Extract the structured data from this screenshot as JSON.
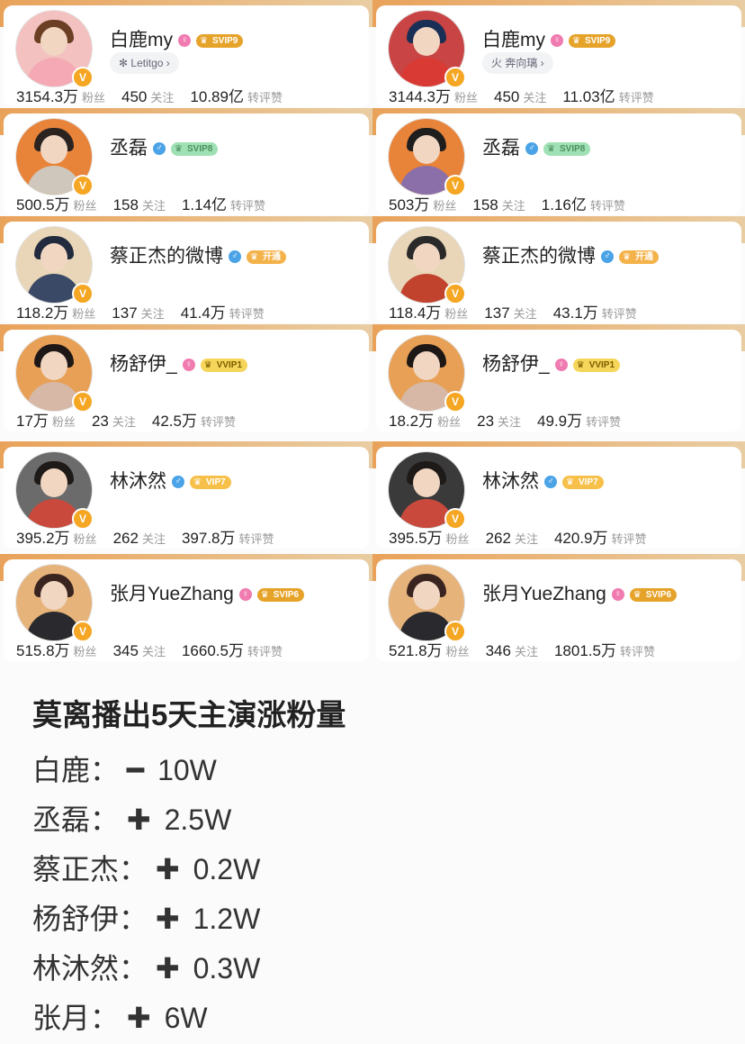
{
  "summary": {
    "title": "莫离播出5天主演涨粉量",
    "rows": [
      {
        "name": "白鹿：",
        "sign": "━",
        "value": "10W"
      },
      {
        "name": "丞磊：",
        "sign": "✚",
        "value": "2.5W"
      },
      {
        "name": "蔡正杰：",
        "sign": "✚",
        "value": "0.2W"
      },
      {
        "name": "杨舒伊：",
        "sign": "✚",
        "value": "1.2W"
      },
      {
        "name": "林沐然：",
        "sign": "✚",
        "value": "0.3W"
      },
      {
        "name": "张月：",
        "sign": "✚",
        "value": "6W"
      }
    ]
  },
  "labels": {
    "fans": "粉丝",
    "follow": "关注",
    "interact": "转评赞"
  },
  "left": [
    {
      "name": "白鹿my",
      "gender": "f",
      "vip": "SVIP9",
      "vip_class": "svip9",
      "chip": "✻ Letitgo ›",
      "fans": "3154.3万",
      "follow": "450",
      "interact": "10.89亿",
      "bg": "#f3c1bf",
      "hair": "#6b3f24",
      "body": "#f4a9b4"
    },
    {
      "name": "丞磊",
      "gender": "m",
      "vip": "SVIP8",
      "vip_class": "svip8",
      "chip": "",
      "fans": "500.5万",
      "follow": "158",
      "interact": "1.14亿",
      "bg": "#e8833a",
      "hair": "#2a2320",
      "body": "#cfc7bb"
    },
    {
      "name": "蔡正杰的微博",
      "gender": "m",
      "vip": "开通",
      "vip_class": "open",
      "chip": "",
      "fans": "118.2万",
      "follow": "137",
      "interact": "41.4万",
      "bg": "#e9d6b8",
      "hair": "#222b3d",
      "body": "#3a4a66"
    },
    {
      "name": "杨舒伊_",
      "gender": "f",
      "vip": "VVIP1",
      "vip_class": "vvip1",
      "chip": "",
      "fans": "17万",
      "follow": "23",
      "interact": "42.5万",
      "bg": "#e7a055",
      "hair": "#1d1716",
      "body": "#d7b7a6"
    },
    {
      "name": "林沐然",
      "gender": "m",
      "vip": "VIP7",
      "vip_class": "vip7",
      "chip": "",
      "fans": "395.2万",
      "follow": "262",
      "interact": "397.8万",
      "bg": "#6b6b6b",
      "hair": "#1e1a18",
      "body": "#c94a3c"
    },
    {
      "name": "张月YueZhang",
      "gender": "f",
      "vip": "SVIP6",
      "vip_class": "svip6",
      "chip": "",
      "fans": "515.8万",
      "follow": "345",
      "interact": "1660.5万",
      "bg": "#e6b37b",
      "hair": "#3a2420",
      "body": "#2a2a2e"
    }
  ],
  "right": [
    {
      "name": "白鹿my",
      "gender": "f",
      "vip": "SVIP9",
      "vip_class": "svip9",
      "chip": "⽕ 奔向璃 ›",
      "fans": "3144.3万",
      "follow": "450",
      "interact": "11.03亿",
      "bg": "#c94444",
      "hair": "#1a2f55",
      "body": "#d93a33"
    },
    {
      "name": "丞磊",
      "gender": "m",
      "vip": "SVIP8",
      "vip_class": "svip8",
      "chip": "",
      "fans": "503万",
      "follow": "158",
      "interact": "1.16亿",
      "bg": "#e8833a",
      "hair": "#1e1e1e",
      "body": "#8b6fa8"
    },
    {
      "name": "蔡正杰的微博",
      "gender": "m",
      "vip": "开通",
      "vip_class": "open",
      "chip": "",
      "fans": "118.4万",
      "follow": "137",
      "interact": "43.1万",
      "bg": "#e9d6b8",
      "hair": "#2a2a2a",
      "body": "#c1432e"
    },
    {
      "name": "杨舒伊_",
      "gender": "f",
      "vip": "VVIP1",
      "vip_class": "vvip1",
      "chip": "",
      "fans": "18.2万",
      "follow": "23",
      "interact": "49.9万",
      "bg": "#e7a055",
      "hair": "#1d1716",
      "body": "#d7b7a6"
    },
    {
      "name": "林沐然",
      "gender": "m",
      "vip": "VIP7",
      "vip_class": "vip7",
      "chip": "",
      "fans": "395.5万",
      "follow": "262",
      "interact": "420.9万",
      "bg": "#3a3a3a",
      "hair": "#1e1a18",
      "body": "#c94a3c"
    },
    {
      "name": "张月YueZhang",
      "gender": "f",
      "vip": "SVIP6",
      "vip_class": "svip6",
      "chip": "",
      "fans": "521.8万",
      "follow": "346",
      "interact": "1801.5万",
      "bg": "#e6b37b",
      "hair": "#3a2420",
      "body": "#2a2a2e"
    }
  ],
  "colors": {
    "strip_warm": "#e9a25a",
    "strip_sand": "#e9cda2",
    "gold": "#f5a623"
  }
}
